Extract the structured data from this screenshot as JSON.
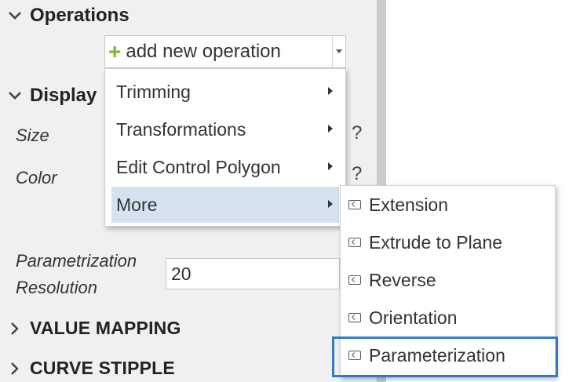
{
  "panel": {
    "operations_header": "Operations",
    "display_header": "Display",
    "size_label": "Size",
    "color_label": "Color",
    "param_label_line1": "Parametrization",
    "param_label_line2": "Resolution",
    "param_value": "20",
    "value_mapping_header": "VALUE MAPPING",
    "curve_stipple_header": "CURVE STIPPLE",
    "help_symbol": "?"
  },
  "add_operation": {
    "plus_icon": "+",
    "label": "add new operation"
  },
  "menu": {
    "items": [
      {
        "label": "Trimming"
      },
      {
        "label": "Transformations"
      },
      {
        "label": "Edit Control Polygon"
      },
      {
        "label": "More"
      }
    ]
  },
  "submenu": {
    "items": [
      {
        "label": "Extension"
      },
      {
        "label": "Extrude to Plane"
      },
      {
        "label": "Reverse"
      },
      {
        "label": "Orientation"
      },
      {
        "label": "Parameterization"
      }
    ]
  },
  "colors": {
    "accent_blue": "#2f7bc8",
    "menu_active_bg": "#d7e2f0",
    "plus_green": "#77b82a"
  }
}
